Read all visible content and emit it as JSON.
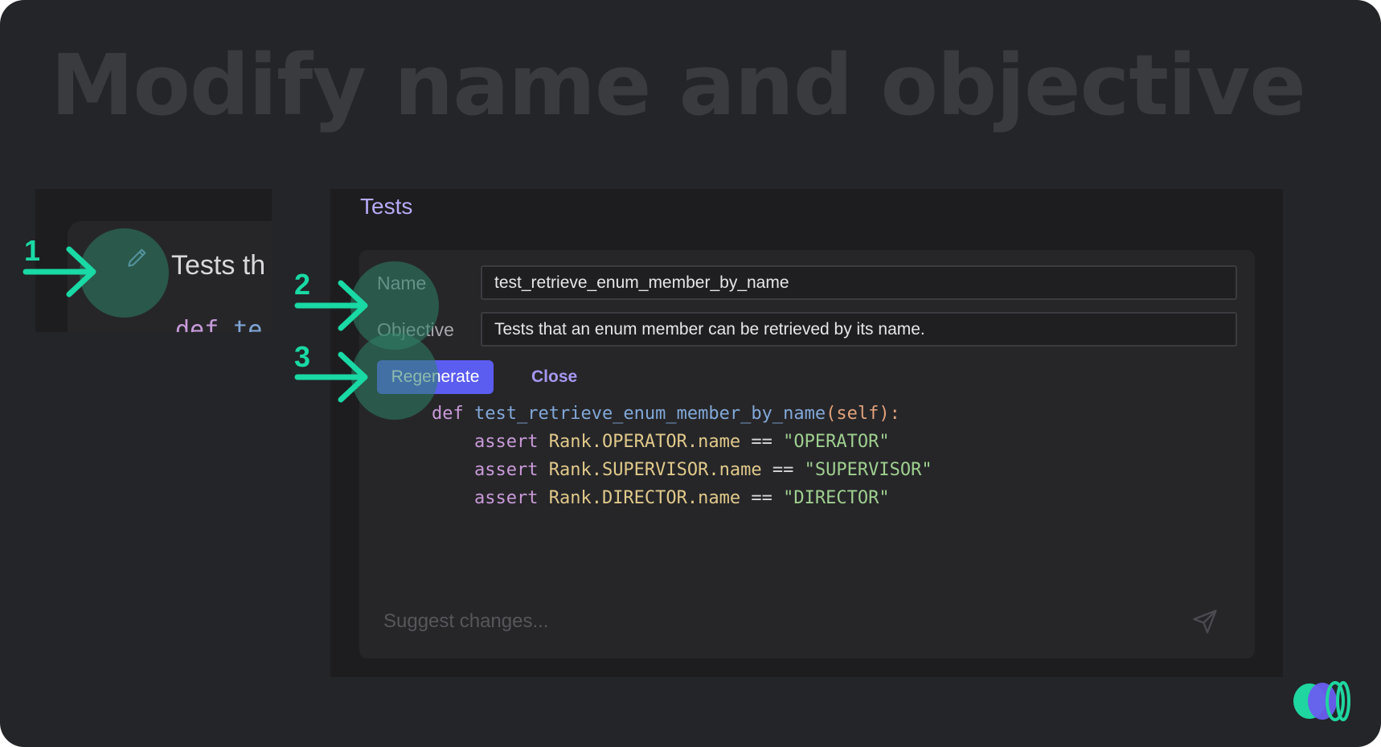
{
  "headline": "Modify name and objective",
  "snippet": {
    "text": "Tests th",
    "code_keyword": "def",
    "code_name": "te"
  },
  "panel": {
    "title": "Tests",
    "name_label": "Name",
    "name_value": "test_retrieve_enum_member_by_name",
    "objective_label": "Objective",
    "objective_value": "Tests that an enum member can be retrieved by its name.",
    "regenerate_label": "Regenerate",
    "close_label": "Close",
    "suggest_placeholder": "Suggest changes..."
  },
  "code": {
    "def_keyword": "def",
    "function_name": "test_retrieve_enum_member_by_name",
    "open_paren": "(",
    "param": "self",
    "close_paren": "):",
    "lines": [
      {
        "keyword": "assert",
        "object": "Rank.OPERATOR.name",
        "operator": "==",
        "value": "\"OPERATOR\""
      },
      {
        "keyword": "assert",
        "object": "Rank.SUPERVISOR.name",
        "operator": "==",
        "value": "\"SUPERVISOR\""
      },
      {
        "keyword": "assert",
        "object": "Rank.DIRECTOR.name",
        "operator": "==",
        "value": "\"DIRECTOR\""
      }
    ]
  },
  "steps": [
    "1",
    "2",
    "3"
  ],
  "icons": {
    "edit": "pencil-icon",
    "send": "send-icon",
    "logo": "logo-icon",
    "arrow": "arrow-right-icon"
  },
  "colors": {
    "accent": "#5b5cf0",
    "annotation": "#19d9a4",
    "title": "#b6aaf7"
  }
}
